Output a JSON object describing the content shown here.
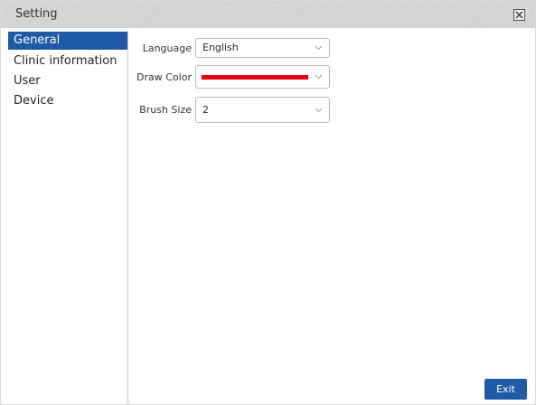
{
  "window": {
    "title": "Setting"
  },
  "sidebar": {
    "items": [
      {
        "label": "General",
        "active": true
      },
      {
        "label": "Clinic information",
        "active": false
      },
      {
        "label": "User",
        "active": false
      },
      {
        "label": "Device",
        "active": false
      }
    ]
  },
  "general": {
    "language": {
      "label": "Language",
      "value": "English"
    },
    "draw_color": {
      "label": "Draw Color",
      "color": "#e8000b"
    },
    "brush_size": {
      "label": "Brush Size",
      "value": "2"
    }
  },
  "footer": {
    "exit_label": "Exit"
  },
  "colors": {
    "accent": "#1f5aa6",
    "titlebar": "#d2d2d2"
  },
  "icons": {
    "close": "close-icon",
    "dropdown": "chevron-down-icon"
  }
}
